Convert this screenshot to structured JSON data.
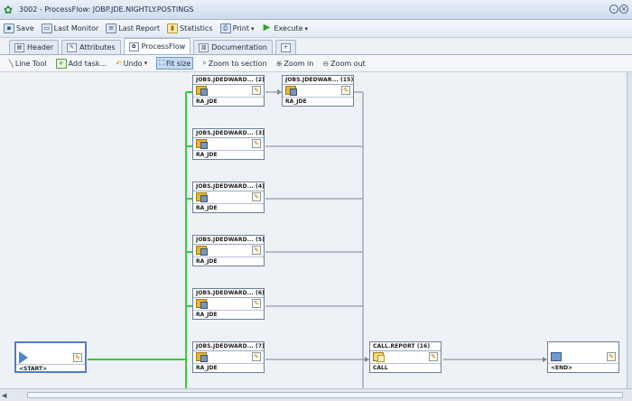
{
  "window": {
    "title": "3002 - ProcessFlow: JOBP.JDE.NIGHTLY.POSTINGS"
  },
  "toolbar": {
    "save": "Save",
    "last_monitor": "Last Monitor",
    "last_report": "Last Report",
    "statistics": "Statistics",
    "print": "Print",
    "execute": "Execute"
  },
  "tabs": [
    "Header",
    "Attributes",
    "ProcessFlow",
    "Documentation"
  ],
  "active_tab": "ProcessFlow",
  "flow_toolbar": {
    "line_tool": "Line Tool",
    "add_task": "Add task...",
    "undo": "Undo",
    "fit_size": "Fit size",
    "zoom_to_section": "Zoom to section",
    "zoom_in": "Zoom in",
    "zoom_out": "Zoom out"
  },
  "nodes": {
    "n2": {
      "title": "JOBS.JDEDWARD... (2)",
      "label": "RA_JDE"
    },
    "n15": {
      "title": "JOBS.JDEDWAR... (15)",
      "label": "RA_JDE"
    },
    "n3": {
      "title": "JOBS.JDEDWARD... (3)",
      "label": "RA_JDE"
    },
    "n4": {
      "title": "JOBS.JDEDWARD... (4)",
      "label": "RA_JDE"
    },
    "n5": {
      "title": "JOBS.JDEDWARD... (5)",
      "label": "RA_JDE"
    },
    "n6": {
      "title": "JOBS.JDEDWARD... (6)",
      "label": "RA_JDE"
    },
    "n7": {
      "title": "JOBS.JDEDWARD... (7)",
      "label": "RA_JDE"
    },
    "n16": {
      "title": "CALL.REPORT (16)",
      "label": "CALL"
    },
    "start": {
      "title": "",
      "label": "<START>"
    },
    "end": {
      "title": "",
      "label": "<END>"
    }
  },
  "colors": {
    "active_line": "#3cc83c",
    "inactive_line": "#7c8798",
    "selected_border": "#4f7ec8"
  }
}
